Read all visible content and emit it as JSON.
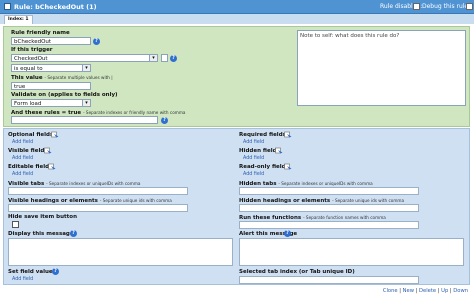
{
  "header": {
    "title": "Rule: bCheckedOut (1)",
    "rule_disabled_label": "Rule disabled:",
    "debug_label": "Debug this rule:"
  },
  "tabs": [
    "Index: 1"
  ],
  "trigger": {
    "friendly_name_label": "Rule friendly name",
    "friendly_name_value": "bCheckedOut",
    "if_trigger_label": "If this trigger",
    "trigger_field_value": "CheckedOut",
    "operator_value": "is equal to",
    "value_label": "This value",
    "value_hint": "- Separate multiple values with |",
    "value_value": "true",
    "validate_label": "Validate on (applies to fields only)",
    "validate_value": "Form load",
    "and_rules_label": "And these rules = true",
    "and_rules_hint": "- Separate indexes or friendly name with comma",
    "and_rules_value": "",
    "note_placeholder": "Note to self: what does this rule do?"
  },
  "actions": {
    "optional_fields_label": "Optional fields",
    "required_fields_label": "Required fields",
    "visible_fields_label": "Visible fields",
    "hidden_fields_label": "Hidden fields",
    "editable_fields_label": "Editable fields",
    "readonly_fields_label": "Read-only fields",
    "add_field": "Add field",
    "visible_tabs_label": "Visible tabs",
    "visible_tabs_hint": "- Separate indexes or uniqueIDs with comma",
    "hidden_tabs_label": "Hidden tabs",
    "hidden_tabs_hint": "- Separate indexes or uniqueIDs with comma",
    "visible_headings_label": "Visible headings or elements",
    "visible_headings_hint": "- Separate unique ids with comma",
    "hidden_headings_label": "Hidden headings or elements",
    "hidden_headings_hint": "- Separate unique ids with comma",
    "hide_save_label": "Hide save item button",
    "run_functions_label": "Run these functions",
    "run_functions_hint": "- Separate function names with comma",
    "display_message_label": "Display this message",
    "alert_message_label": "Alert this message",
    "set_field_value_label": "Set field value",
    "selected_tab_label": "Selected tab index (or Tab unique ID)"
  },
  "footer": {
    "links": [
      "Clone",
      "New",
      "Delete",
      "Up",
      "Down"
    ]
  },
  "colors": {
    "header_bg": "#4f93d3",
    "trigger_bg": "#cfe6c1",
    "actions_bg": "#cfe0f3",
    "link": "#2a5db0",
    "help_icon": "#2f6fd0"
  }
}
